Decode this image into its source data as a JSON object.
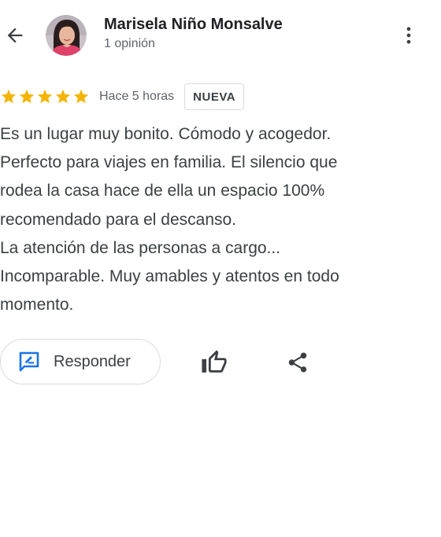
{
  "header": {
    "author_name": "Marisela Niño Monsalve",
    "review_count": "1 opinión",
    "avatar_icon": "profile-photo",
    "back_icon": "arrow-back-icon",
    "menu_icon": "more-vert-icon"
  },
  "review": {
    "rating": 5,
    "max_rating": 5,
    "time_ago": "Hace 5 horas",
    "badge": "NUEVA",
    "text_lines": [
      "Es un lugar muy bonito. Cómodo y acogedor.",
      "Perfecto para viajes en familia. El silencio que",
      "rodea la casa hace de ella un espacio 100%",
      "recomendado para el descanso.",
      "La atención de las personas a cargo...",
      "Incomparable. Muy amables y atentos en todo",
      "momento."
    ]
  },
  "actions": {
    "reply_label": "Responder",
    "reply_icon": "rate-review-icon",
    "like_icon": "thumb-up-icon",
    "share_icon": "share-icon"
  },
  "colors": {
    "star": "#f4b400",
    "accent": "#1a73e8",
    "text_primary": "#202124",
    "text_secondary": "#5f6368",
    "border": "#dadce0"
  }
}
